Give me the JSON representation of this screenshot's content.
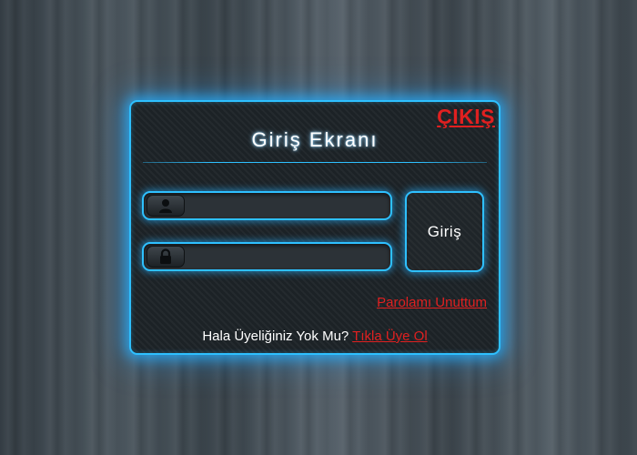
{
  "panel": {
    "exit_label": "ÇIKIŞ",
    "title": "Giriş Ekranı",
    "username": {
      "icon": "user-icon",
      "value": "",
      "placeholder": ""
    },
    "password": {
      "icon": "lock-icon",
      "value": "",
      "placeholder": ""
    },
    "login_label": "Giriş",
    "forgot_label": "Parolamı Unuttum",
    "signup_prompt": "Hala Üyeliğiniz Yok Mu?",
    "signup_link": "Tıkla Üye Ol"
  },
  "colors": {
    "accent": "#2ec0ff",
    "link": "#e02020",
    "panel_bg": "#1c2226",
    "text": "#ffffff"
  }
}
